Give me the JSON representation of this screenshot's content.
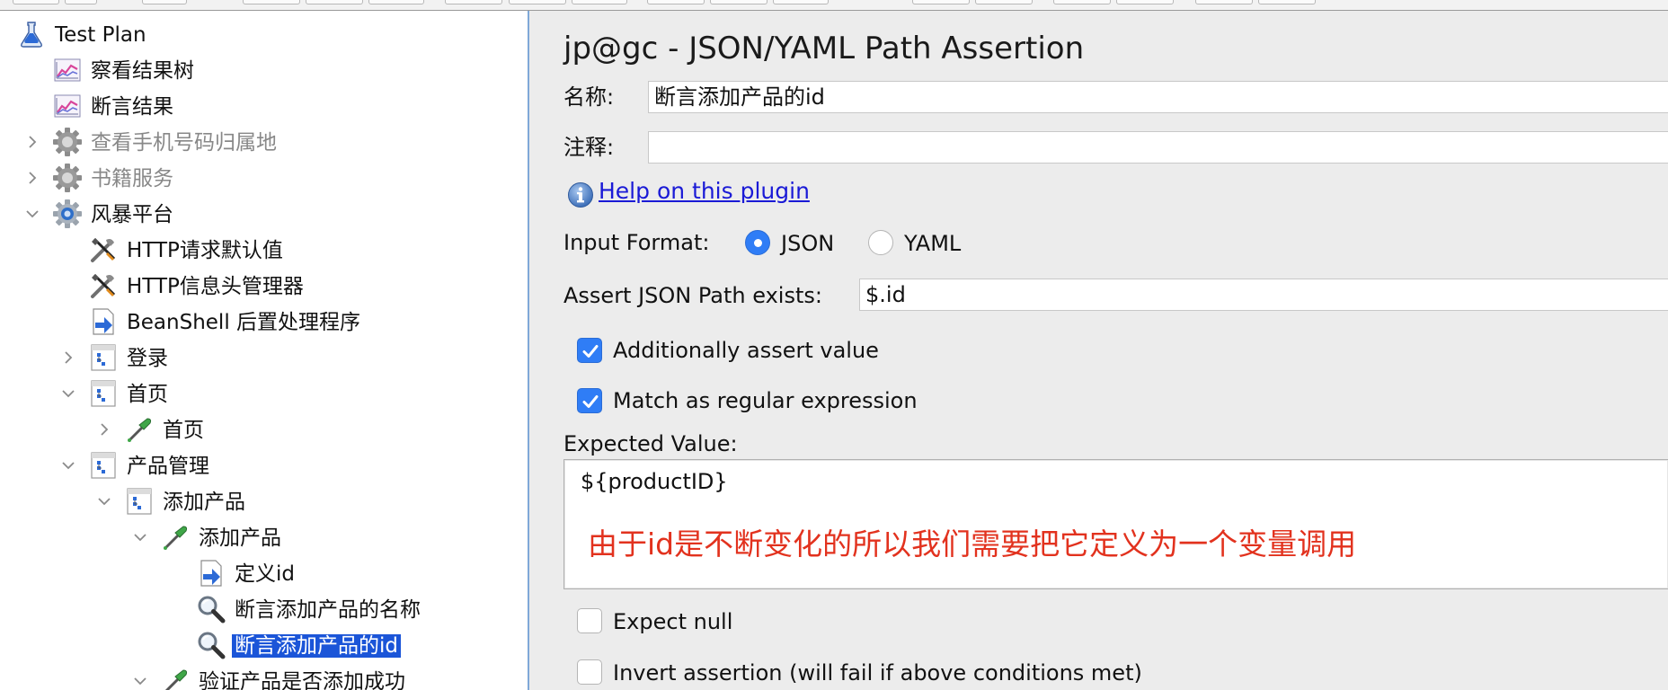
{
  "tree": {
    "nodes": [
      {
        "id": "test-plan",
        "label": "Test Plan",
        "icon": "test-plan-flask-icon",
        "state": "normal",
        "caret": "none"
      },
      {
        "id": "view-results-tree",
        "label": "察看结果树",
        "icon": "graph-listener-icon",
        "state": "normal",
        "caret": "none"
      },
      {
        "id": "assertion-results",
        "label": "断言结果",
        "icon": "graph-listener-icon",
        "state": "normal",
        "caret": "none"
      },
      {
        "id": "phone-location",
        "label": "查看手机号码归属地",
        "icon": "gear-icon",
        "state": "disabled",
        "caret": "collapsed"
      },
      {
        "id": "book-service",
        "label": "书籍服务",
        "icon": "gear-icon",
        "state": "disabled",
        "caret": "collapsed"
      },
      {
        "id": "storm-platform",
        "label": "风暴平台",
        "icon": "gear-icon",
        "state": "normal",
        "caret": "expanded"
      },
      {
        "id": "http-defaults",
        "label": "HTTP请求默认值",
        "icon": "wrench-screwdriver-icon",
        "state": "normal",
        "caret": "none"
      },
      {
        "id": "http-header-manager",
        "label": "HTTP信息头管理器",
        "icon": "wrench-screwdriver-icon",
        "state": "normal",
        "caret": "none"
      },
      {
        "id": "beanshell-postprocessor",
        "label": "BeanShell 后置处理程序",
        "icon": "postprocessor-arrow-icon",
        "state": "normal",
        "caret": "none"
      },
      {
        "id": "login",
        "label": "登录",
        "icon": "controller-icon",
        "state": "normal",
        "caret": "collapsed"
      },
      {
        "id": "homepage-controller",
        "label": "首页",
        "icon": "controller-icon",
        "state": "normal",
        "caret": "expanded"
      },
      {
        "id": "homepage-sampler",
        "label": "首页",
        "icon": "sampler-pipette-icon",
        "state": "normal",
        "caret": "collapsed"
      },
      {
        "id": "product-management",
        "label": "产品管理",
        "icon": "controller-icon",
        "state": "normal",
        "caret": "expanded"
      },
      {
        "id": "add-product-controller",
        "label": "添加产品",
        "icon": "controller-icon",
        "state": "normal",
        "caret": "expanded"
      },
      {
        "id": "add-product-sampler",
        "label": "添加产品",
        "icon": "sampler-pipette-icon",
        "state": "normal",
        "caret": "expanded"
      },
      {
        "id": "define-id",
        "label": "定义id",
        "icon": "postprocessor-arrow-icon",
        "state": "normal",
        "caret": "none"
      },
      {
        "id": "assert-product-name",
        "label": "断言添加产品的名称",
        "icon": "assertion-magnifier-icon",
        "state": "normal",
        "caret": "none"
      },
      {
        "id": "assert-product-id",
        "label": "断言添加产品的id",
        "icon": "assertion-magnifier-icon",
        "state": "selected",
        "caret": "none"
      },
      {
        "id": "verify-product-added",
        "label": "验证产品是否添加成功",
        "icon": "sampler-pipette-icon",
        "state": "normal",
        "caret": "expanded"
      }
    ]
  },
  "editor": {
    "title": "jp@gc - JSON/YAML Path Assertion",
    "name_label": "名称:",
    "name_value": "断言添加产品的id",
    "comment_label": "注释:",
    "comment_value": "",
    "help_link": "Help on this plugin",
    "input_format_label": "Input Format:",
    "format_options": [
      {
        "label": "JSON",
        "selected": true
      },
      {
        "label": "YAML",
        "selected": false
      }
    ],
    "path_label": "Assert JSON Path exists:",
    "path_value": "$.id",
    "additionally_assert_value": {
      "label": "Additionally assert value",
      "checked": true
    },
    "match_regex": {
      "label": "Match as regular expression",
      "checked": true
    },
    "expected_value_label": "Expected Value:",
    "expected_value": "${productID}",
    "annotation": "由于id是不断变化的所以我们需要把它定义为一个变量调用",
    "expect_null": {
      "label": "Expect null",
      "checked": false
    },
    "invert_assertion": {
      "label": "Invert assertion (will fail if above conditions met)",
      "checked": false
    }
  },
  "colors": {
    "selection": "#1b55d8",
    "checkbox_on": "#2f7df6",
    "link": "#1a1ad6",
    "annotation": "#e2321e",
    "disabled_text": "#888888"
  }
}
